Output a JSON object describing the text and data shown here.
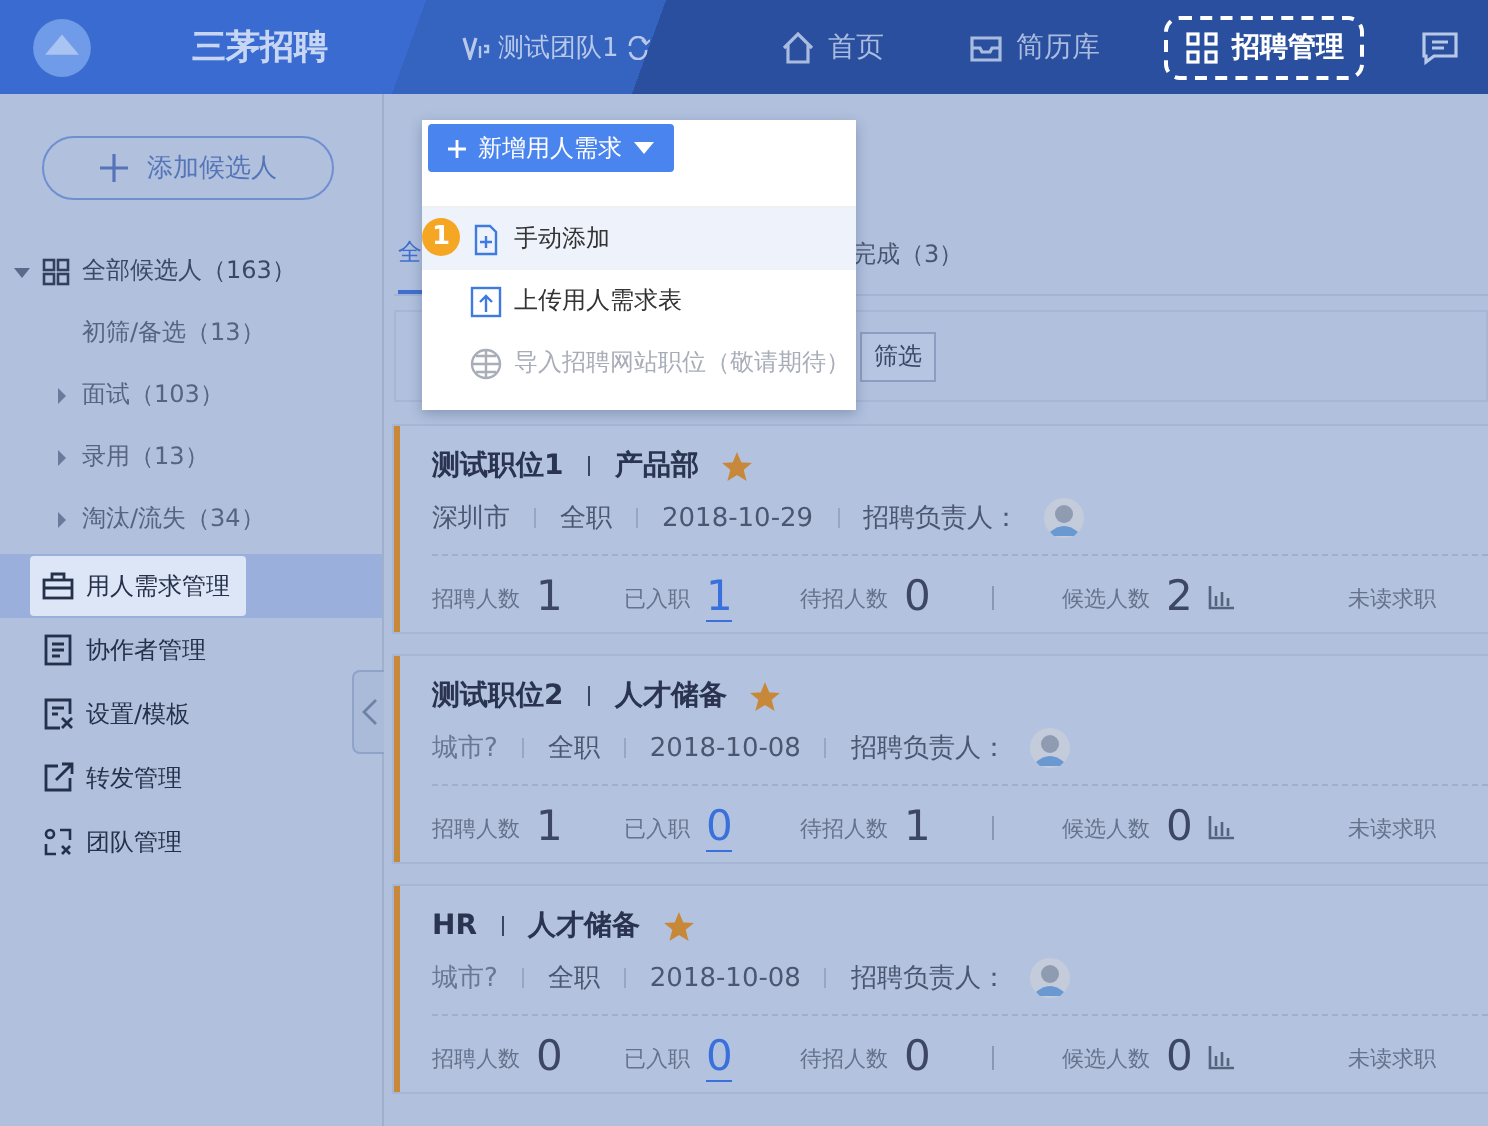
{
  "header": {
    "brand": "三茅招聘",
    "team": "测试团队1",
    "nav": [
      {
        "label": "首页",
        "selected": false
      },
      {
        "label": "简历库",
        "selected": false
      },
      {
        "label": "招聘管理",
        "selected": true
      }
    ]
  },
  "sidebar": {
    "add_button": "添加候选人",
    "tree": [
      {
        "label": "全部候选人（163）",
        "expanded": true,
        "children": [
          {
            "label": "初筛/备选（13）",
            "kind": "leaf"
          },
          {
            "label": "面试（103）",
            "kind": "group"
          },
          {
            "label": "录用（13）",
            "kind": "group"
          },
          {
            "label": "淘汰/流失（34）",
            "kind": "group"
          }
        ]
      }
    ],
    "menu": [
      {
        "label": "用人需求管理",
        "selected": true
      },
      {
        "label": "协作者管理",
        "selected": false
      },
      {
        "label": "设置/模板",
        "selected": false
      },
      {
        "label": "转发管理",
        "selected": false
      },
      {
        "label": "团队管理",
        "selected": false
      }
    ]
  },
  "content": {
    "new_button": "新增用人需求",
    "dropdown": [
      {
        "label": "手动添加",
        "highlighted": true,
        "disabled": false,
        "step": "1"
      },
      {
        "label": "上传用人需求表",
        "highlighted": false,
        "disabled": false
      },
      {
        "label": "导入招聘网站职位（敬请期待）",
        "highlighted": false,
        "disabled": true
      }
    ],
    "tabs": [
      {
        "label": "全",
        "selected": true
      },
      {
        "label": "完成（3）",
        "selected": false
      }
    ],
    "filter_button": "筛选",
    "jobs": [
      {
        "title": "测试职位1",
        "department": "产品部",
        "starred": true,
        "city": "深圳市",
        "city_set": true,
        "type": "全职",
        "date": "2018-10-29",
        "owner_label": "招聘负责人：",
        "stats": [
          {
            "label": "招聘人数",
            "value": "1"
          },
          {
            "label": "已入职",
            "value": "1",
            "link": true
          },
          {
            "label": "待招人数",
            "value": "0"
          }
        ],
        "candidates_label": "候选人数",
        "candidates": "2",
        "unread_label": "未读求职"
      },
      {
        "title": "测试职位2",
        "department": "人才储备",
        "starred": true,
        "city": "城市?",
        "city_set": false,
        "type": "全职",
        "date": "2018-10-08",
        "owner_label": "招聘负责人：",
        "stats": [
          {
            "label": "招聘人数",
            "value": "1"
          },
          {
            "label": "已入职",
            "value": "0",
            "link": true
          },
          {
            "label": "待招人数",
            "value": "1"
          }
        ],
        "candidates_label": "候选人数",
        "candidates": "0",
        "unread_label": "未读求职"
      },
      {
        "title": "HR",
        "department": "人才储备",
        "starred": true,
        "city": "城市?",
        "city_set": false,
        "type": "全职",
        "date": "2018-10-08",
        "owner_label": "招聘负责人：",
        "stats": [
          {
            "label": "招聘人数",
            "value": "0"
          },
          {
            "label": "已入职",
            "value": "0",
            "link": true
          },
          {
            "label": "待招人数",
            "value": "0"
          }
        ],
        "candidates_label": "候选人数",
        "candidates": "0",
        "unread_label": "未读求职"
      }
    ]
  }
}
